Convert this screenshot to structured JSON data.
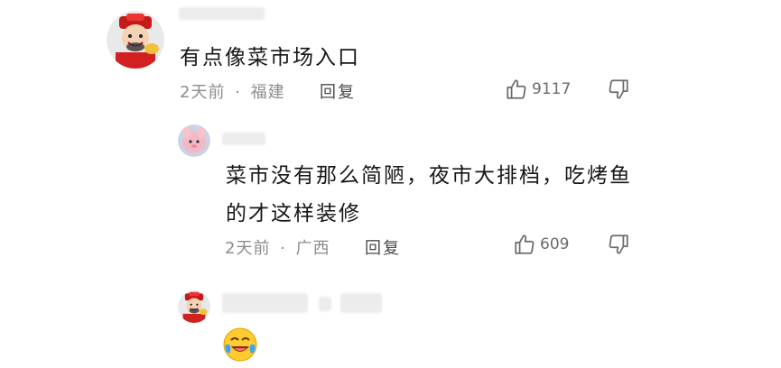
{
  "comments": [
    {
      "text": "有点像菜市场入口",
      "time": "2天前",
      "separator": "·",
      "location": "福建",
      "reply_label": "回复",
      "likes": "9117",
      "avatar_icon": "caishen-avatar-icon"
    },
    {
      "text": "菜市没有那么简陋，夜市大排档，吃烤鱼的才这样装修",
      "time": "2天前",
      "separator": "·",
      "location": "广西",
      "reply_label": "回复",
      "likes": "609",
      "avatar_icon": "pink-cartoon-avatar-icon"
    },
    {
      "emoji": "laughing-crying-emoji",
      "avatar_icon": "caishen-avatar-icon"
    }
  ],
  "colors": {
    "meta_gray": "#8c8c8c",
    "text_dark": "#161616",
    "icon_gray": "#6b6b6b"
  }
}
